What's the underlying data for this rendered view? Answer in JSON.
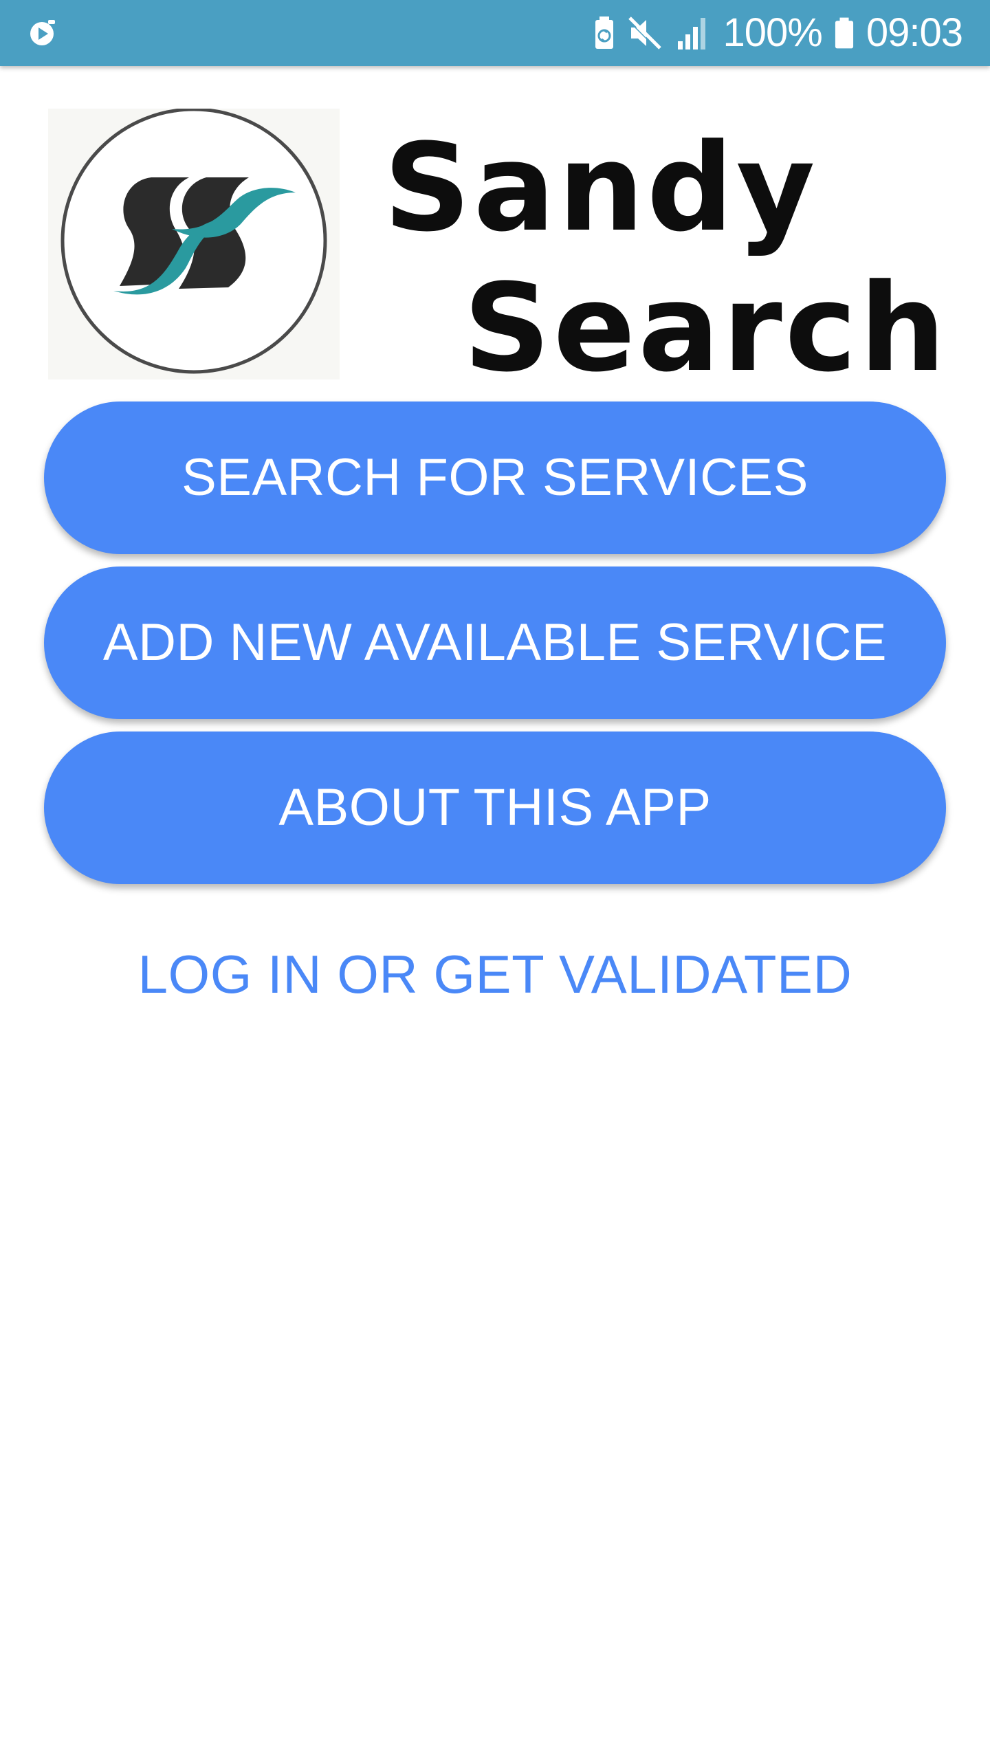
{
  "status_bar": {
    "left_icon": "screen-recorder-icon",
    "icons": [
      "battery-saver-icon",
      "mute-icon",
      "signal-icon",
      "battery-icon"
    ],
    "battery_percent": "100%",
    "time": "09:03"
  },
  "logo": {
    "emblem_icon": "sandy-search-logo-icon",
    "word_1": "Sandy",
    "word_2": "Search",
    "colors": {
      "teal": "#2a9a9f",
      "dark": "#2b2b2b"
    }
  },
  "menu": {
    "search_label": "SEARCH FOR SERVICES",
    "add_label": "ADD NEW AVAILABLE SERVICE",
    "about_label": "ABOUT THIS APP",
    "login_label": "LOG IN OR GET VALIDATED"
  },
  "colors": {
    "status_bar": "#4a9fc2",
    "accent": "#4a88f7",
    "button_text": "#ffffff",
    "background": "#ffffff"
  }
}
